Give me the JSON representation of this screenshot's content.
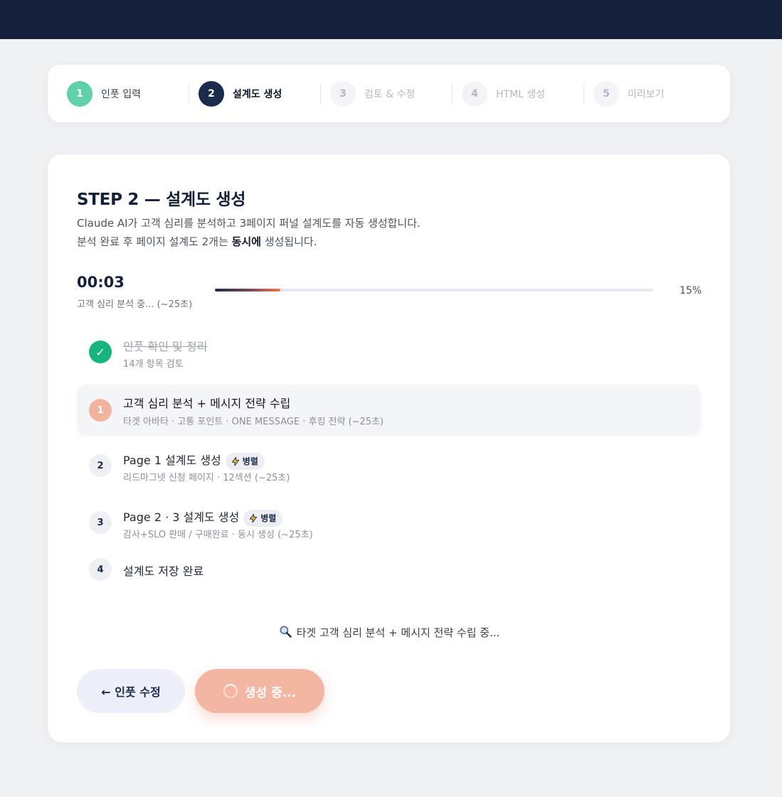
{
  "stepper": [
    {
      "num": "1",
      "label": "인풋 입력",
      "state": "done"
    },
    {
      "num": "2",
      "label": "설계도 생성",
      "state": "active"
    },
    {
      "num": "3",
      "label": "검토 & 수정",
      "state": "pending"
    },
    {
      "num": "4",
      "label": "HTML 생성",
      "state": "pending"
    },
    {
      "num": "5",
      "label": "미리보기",
      "state": "pending"
    }
  ],
  "card": {
    "title": "STEP 2 — 설계도 생성",
    "desc_line1": "Claude AI가 고객 심리를 분석하고 3페이지 퍼널 설계도를 자동 생성합니다.",
    "desc_line2_a": "분석 완료 후 페이지 설계도 2개는 ",
    "desc_line2_b": "동시에",
    "desc_line2_c": " 생성됩니다."
  },
  "progress": {
    "timer": "00:03",
    "status": "고객 심리 분석 중... (~25초)",
    "percent_label": "15%",
    "fraction": 0.15
  },
  "tasks": [
    {
      "badge": "✓",
      "title": "인풋 확인 및 정리",
      "sub": "14개 항목 검토",
      "state": "done"
    },
    {
      "badge": "1",
      "title": "고객 심리 분석 + 메시지 전략 수립",
      "sub": "타겟 아바타 · 고통 포인트 · ONE MESSAGE · 후킹 전략 (~25초)",
      "state": "current"
    },
    {
      "badge": "2",
      "title": "Page 1 설계도 생성",
      "pill": "병렬",
      "sub": "리드마그넷 신청 페이지 · 12섹션 (~25초)",
      "state": "wait"
    },
    {
      "badge": "3",
      "title": "Page 2 · 3 설계도 생성",
      "pill": "병렬",
      "sub": "감사+SLO 판매 / 구매완료 · 동시 생성 (~25초)",
      "state": "wait"
    },
    {
      "badge": "4",
      "title": "설계도 저장 완료",
      "state": "wait"
    }
  ],
  "status_line": "타겟 고객 심리 분석 + 메시지 전략 수립 중...",
  "buttons": {
    "back": "← 인풋 수정",
    "generating": "생성 중..."
  },
  "colors": {
    "navy": "#141f3a",
    "done_green": "#16b57e",
    "accent_peach": "#f3b6a3",
    "progress_orange": "#ea7a4c"
  }
}
